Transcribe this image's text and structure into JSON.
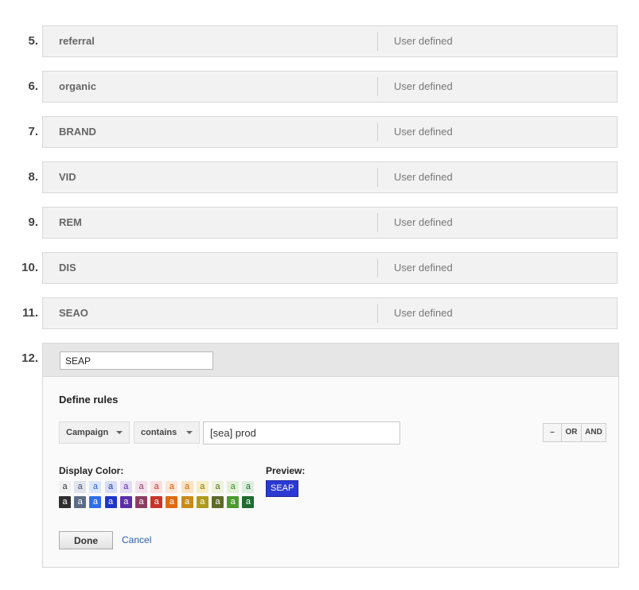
{
  "rows": [
    {
      "num": "5.",
      "name": "referral",
      "type": "User defined"
    },
    {
      "num": "6.",
      "name": "organic",
      "type": "User defined"
    },
    {
      "num": "7.",
      "name": "BRAND",
      "type": "User defined"
    },
    {
      "num": "8.",
      "name": "VID",
      "type": "User defined"
    },
    {
      "num": "9.",
      "name": "REM",
      "type": "User defined"
    },
    {
      "num": "10.",
      "name": "DIS",
      "type": "User defined"
    },
    {
      "num": "11.",
      "name": "SEAO",
      "type": "User defined"
    }
  ],
  "editor": {
    "num": "12.",
    "name_value": "SEAP",
    "define_rules": "Define rules",
    "dimension": "Campaign",
    "operator": "contains",
    "rule_value": "[sea] prod",
    "minus": "–",
    "or": "OR",
    "and": "AND",
    "display_color": "Display Color:",
    "preview": "Preview:",
    "preview_text": "SEAP",
    "swatch_letter": "a",
    "done": "Done",
    "cancel": "Cancel"
  },
  "colors": {
    "light_row": [
      {
        "bg": "#f1f1f1",
        "fg": "#333333"
      },
      {
        "bg": "#dfe3ea",
        "fg": "#4a5570"
      },
      {
        "bg": "#dbe6fb",
        "fg": "#2a5fd0"
      },
      {
        "bg": "#d6dcfa",
        "fg": "#2233bb"
      },
      {
        "bg": "#e2dcf4",
        "fg": "#5a2fa0"
      },
      {
        "bg": "#f4e0ea",
        "fg": "#8a3a5a"
      },
      {
        "bg": "#fbe0dd",
        "fg": "#c0392b"
      },
      {
        "bg": "#fbe5d6",
        "fg": "#d35400"
      },
      {
        "bg": "#fbe2c2",
        "fg": "#b06d10"
      },
      {
        "bg": "#f8efc0",
        "fg": "#8a7010"
      },
      {
        "bg": "#eef2dc",
        "fg": "#5a6a20"
      },
      {
        "bg": "#e3f0d8",
        "fg": "#3a8a2a"
      },
      {
        "bg": "#dceedd",
        "fg": "#1f6b30"
      }
    ],
    "dark_row": [
      {
        "bg": "#2e2e2e",
        "fg": "#ffffff"
      },
      {
        "bg": "#5d6d85",
        "fg": "#ffffff"
      },
      {
        "bg": "#2f6ee8",
        "fg": "#ffffff"
      },
      {
        "bg": "#2035c8",
        "fg": "#ffffff"
      },
      {
        "bg": "#5b2ea8",
        "fg": "#ffffff"
      },
      {
        "bg": "#8a3e62",
        "fg": "#ffffff"
      },
      {
        "bg": "#c8342a",
        "fg": "#ffffff"
      },
      {
        "bg": "#e06a10",
        "fg": "#ffffff"
      },
      {
        "bg": "#c98a1a",
        "fg": "#ffffff"
      },
      {
        "bg": "#b09a1a",
        "fg": "#ffffff"
      },
      {
        "bg": "#5e6a2a",
        "fg": "#ffffff"
      },
      {
        "bg": "#4a9a30",
        "fg": "#ffffff"
      },
      {
        "bg": "#1f6b30",
        "fg": "#ffffff"
      }
    ]
  }
}
